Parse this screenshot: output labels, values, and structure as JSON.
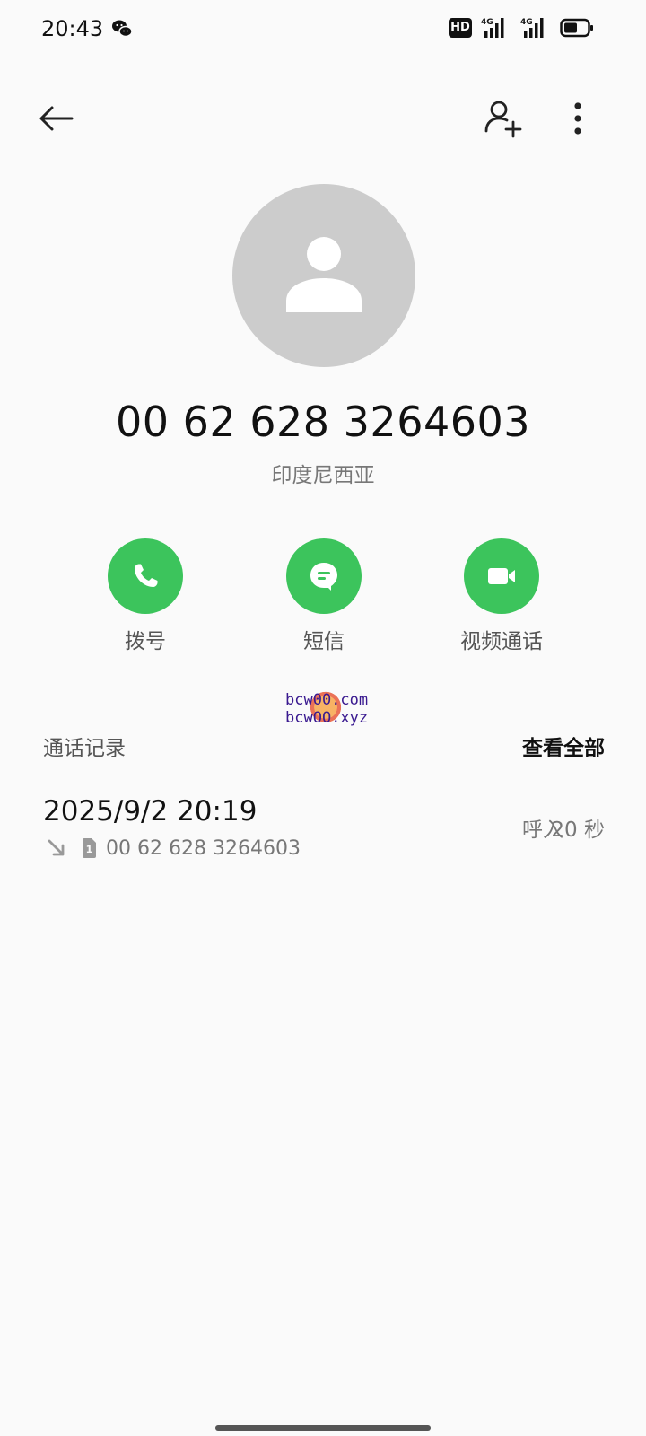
{
  "status_bar": {
    "time": "20:43",
    "hd_label": "HD",
    "network_1": "4G",
    "network_2": "4G",
    "icons": [
      "wechat-icon",
      "hd-icon",
      "signal-icon",
      "signal-icon",
      "battery-icon"
    ]
  },
  "nav": {
    "icons": [
      "back-arrow-icon",
      "add-contact-icon",
      "more-vertical-icon"
    ]
  },
  "contact": {
    "number": "00 62 628 3264603",
    "location": "印度尼西亚"
  },
  "actions": [
    {
      "label": "拨号",
      "icon": "phone-icon"
    },
    {
      "label": "短信",
      "icon": "message-icon"
    },
    {
      "label": "视频通话",
      "icon": "video-icon"
    }
  ],
  "watermark": {
    "line1": "bcw00.com",
    "line2": "bcwOO.xyz"
  },
  "call_log": {
    "title": "通话记录",
    "view_all": "查看全部",
    "entries": [
      {
        "datetime": "2025/9/2 20:19",
        "number": "00 62 628 3264603",
        "type": "呼入",
        "duration": "20 秒",
        "sim": "1",
        "direction_icon": "incoming-call-icon"
      }
    ]
  },
  "colors": {
    "accent_green": "#3cc45c",
    "avatar_gray": "#cccccc",
    "background": "#fafafa"
  }
}
